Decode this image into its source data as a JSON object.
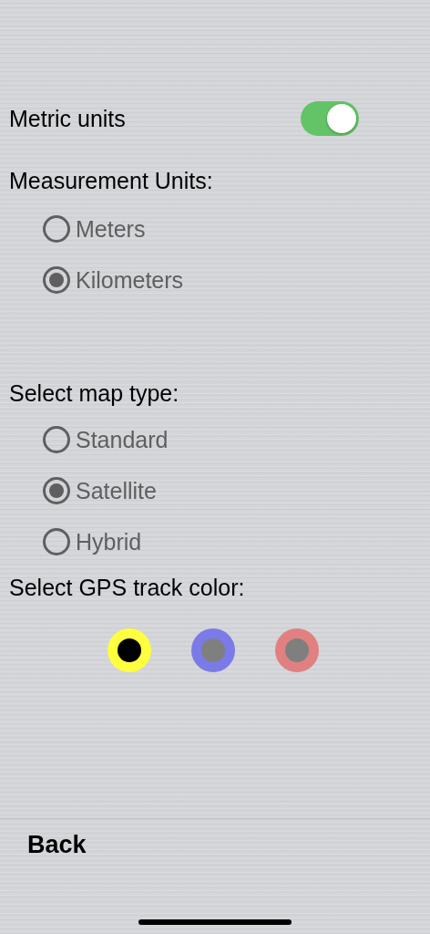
{
  "metric_units": {
    "label": "Metric units",
    "on": true
  },
  "measurement_units": {
    "label": "Measurement Units:",
    "options": [
      {
        "label": "Meters",
        "selected": false
      },
      {
        "label": "Kilometers",
        "selected": true
      }
    ]
  },
  "map_type": {
    "label": "Select map type:",
    "options": [
      {
        "label": "Standard",
        "selected": false
      },
      {
        "label": "Satellite",
        "selected": true
      },
      {
        "label": "Hybrid",
        "selected": false
      }
    ]
  },
  "track_color": {
    "label": "Select GPS track color:",
    "options": [
      {
        "color": "#ffff40",
        "selected": true
      },
      {
        "color": "#7b7be8",
        "selected": false
      },
      {
        "color": "#e08080",
        "selected": false
      }
    ]
  },
  "back_button": "Back"
}
